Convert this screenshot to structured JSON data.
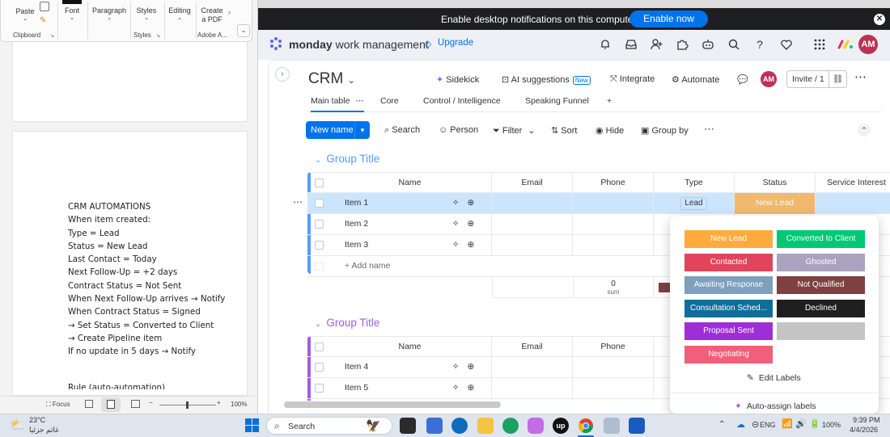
{
  "word": {
    "ribbon": {
      "paste": "Paste",
      "font": "Font",
      "paragraph": "Paragraph",
      "styles": "Styles",
      "editing": "Editing",
      "create_pdf": "Create a PDF",
      "groups": {
        "clipboard": "Clipboard",
        "styles": "Styles",
        "adobe": "Adobe A..."
      }
    },
    "doc_lines": [
      "CRM AUTOMATIONS",
      "When item created:",
      "Type = Lead",
      "Status = New Lead",
      "Last Contact = Today",
      "Next Follow-Up = +2 days",
      "Contract Status = Not Sent",
      "When Next Follow-Up arrives → Notify",
      "When Contract Status = Signed",
      "→ Set Status = Converted to Client",
      "→ Create Pipeline item",
      "If no update in 5 days → Notify"
    ],
    "doc_cut_line": "Rule (auto-automation)",
    "status_bar": {
      "focus": "Focus",
      "zoom": "100%"
    }
  },
  "browser": {
    "notification": {
      "text": "Enable desktop notifications on this computer",
      "enable_button": "Enable now"
    },
    "brand": {
      "bold": "monday",
      "rest": " work management"
    },
    "upgrade": "Upgrade",
    "avatar": "AM",
    "board": {
      "title": "CRM",
      "sidekick": "Sidekick",
      "ai_suggestions": "AI suggestions",
      "ai_new": "New",
      "integrate": "Integrate",
      "automate": "Automate",
      "invite": "Invite / 1",
      "tabs": [
        "Main table",
        "Core",
        "Control / Intelligence",
        "Speaking Funnel",
        "+"
      ],
      "toolbar": {
        "new_item": "New name",
        "search": "Search",
        "person": "Person",
        "filter": "Filter",
        "sort": "Sort",
        "hide": "Hide",
        "group_by": "Group by"
      },
      "columns": [
        "Name",
        "Email",
        "Phone",
        "Type",
        "Status",
        "Service Interest"
      ],
      "group1": {
        "title": "Group Title",
        "items": [
          {
            "name": "Item 1",
            "type": "Lead",
            "status": "New Lead"
          },
          {
            "name": "Item 2",
            "type": "",
            "status": ""
          },
          {
            "name": "Item 3",
            "type": "",
            "status": ""
          }
        ],
        "add_name": "+ Add name",
        "summary_value": "0",
        "summary_label": "sum"
      },
      "group2": {
        "title": "Group Title",
        "items": [
          {
            "name": "Item 4"
          },
          {
            "name": "Item 5"
          }
        ]
      },
      "status_picker": {
        "labels": [
          {
            "text": "New Lead",
            "color": "#fdab3d"
          },
          {
            "text": "Converted to Client",
            "color": "#00c875"
          },
          {
            "text": "Contacted",
            "color": "#e2445c"
          },
          {
            "text": "Ghosted",
            "color": "#a9a3bf"
          },
          {
            "text": "Awaiting Response",
            "color": "#7e9fbd"
          },
          {
            "text": "Not Qualified",
            "color": "#7f4040"
          },
          {
            "text": "Consultation Sched...",
            "color": "#0e6f9c"
          },
          {
            "text": "Declined",
            "color": "#1f1f1f"
          },
          {
            "text": "Proposal Sent",
            "color": "#9d2fd9"
          },
          {
            "text": "",
            "color": "#c4c4c4"
          },
          {
            "text": "Negotiating",
            "color": "#f0607a"
          }
        ],
        "edit_labels": "Edit Labels",
        "auto_assign": "Auto-assign labels"
      }
    }
  },
  "taskbar": {
    "weather_temp": "23°C",
    "weather_desc": "غائم جزئيا",
    "search": "Search",
    "lang": "ENG",
    "battery": "100%",
    "time": "9:39 PM",
    "date": "4/4/2026"
  }
}
